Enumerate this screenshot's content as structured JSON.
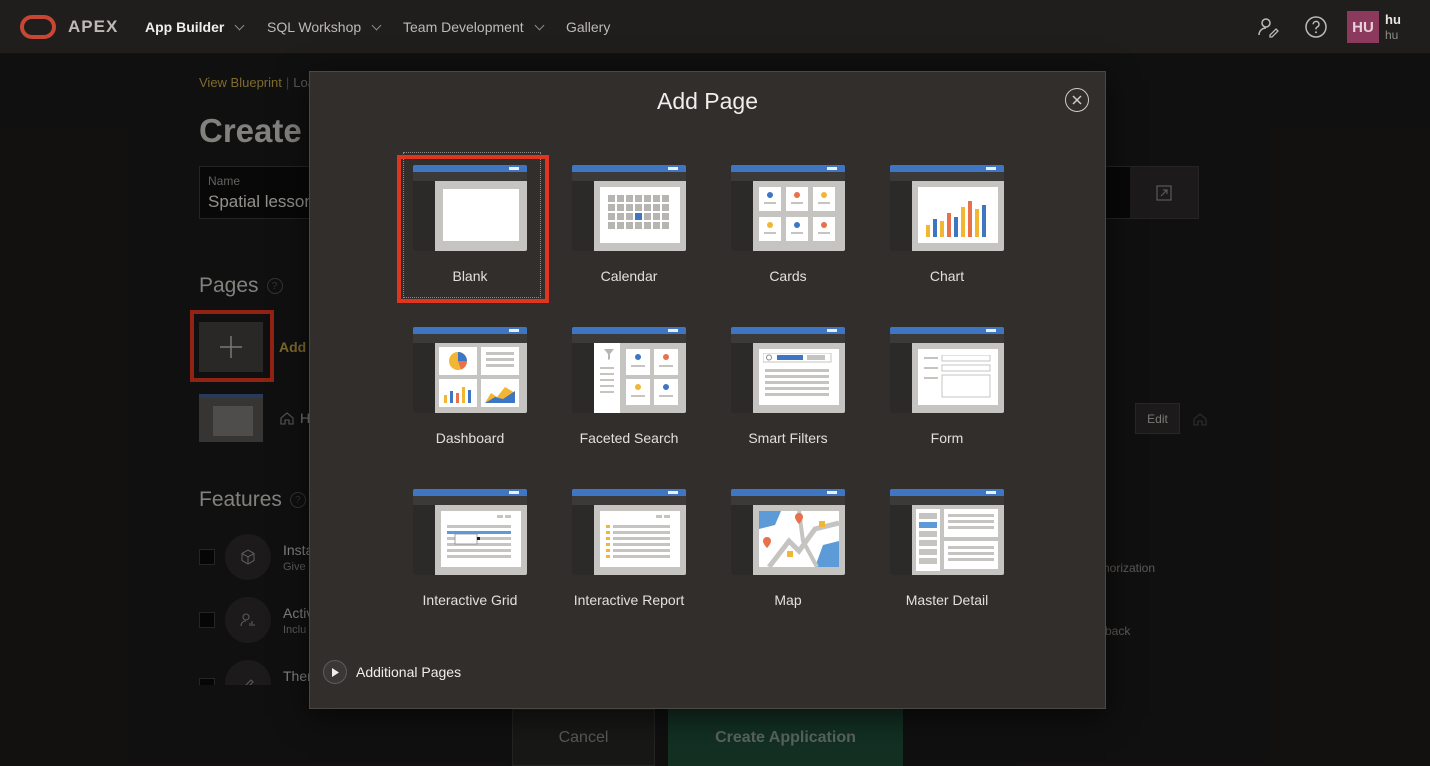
{
  "topbar": {
    "brand": "APEX",
    "nav": [
      {
        "label": "App Builder"
      },
      {
        "label": "SQL Workshop"
      },
      {
        "label": "Team Development"
      },
      {
        "label": "Gallery"
      }
    ],
    "user": {
      "initials": "HU",
      "name": "hu",
      "sub": "hu"
    }
  },
  "background": {
    "breadcrumb": {
      "link": "View Blueprint",
      "rest": "Loa"
    },
    "heading": "Create a",
    "name_field": {
      "label": "Name",
      "value": "Spatial lesson"
    },
    "pages_heading": "Pages",
    "add_label": "Add",
    "home_row_label": "H",
    "edit_label": "Edit",
    "features_heading": "Features",
    "features": [
      {
        "title": "Insta",
        "sub": "Give"
      },
      {
        "title": "Activ",
        "sub": "Inclu"
      },
      {
        "title": "Ther",
        "sub": ""
      }
    ],
    "side_texts": [
      "horization",
      "back"
    ],
    "cancel_label": "Cancel",
    "create_label": "Create Application"
  },
  "dialog": {
    "title": "Add Page",
    "tiles": [
      {
        "label": "Blank"
      },
      {
        "label": "Calendar"
      },
      {
        "label": "Cards"
      },
      {
        "label": "Chart"
      },
      {
        "label": "Dashboard"
      },
      {
        "label": "Faceted Search"
      },
      {
        "label": "Smart Filters"
      },
      {
        "label": "Form"
      },
      {
        "label": "Interactive Grid"
      },
      {
        "label": "Interactive Report"
      },
      {
        "label": "Map"
      },
      {
        "label": "Master Detail"
      }
    ],
    "additional_label": "Additional Pages",
    "selected": "Blank"
  },
  "colors": {
    "accent_red": "#e0351e",
    "brand_red": "#c74634",
    "link_gold": "#c2a344",
    "thumb_blue": "#3f76c4"
  }
}
